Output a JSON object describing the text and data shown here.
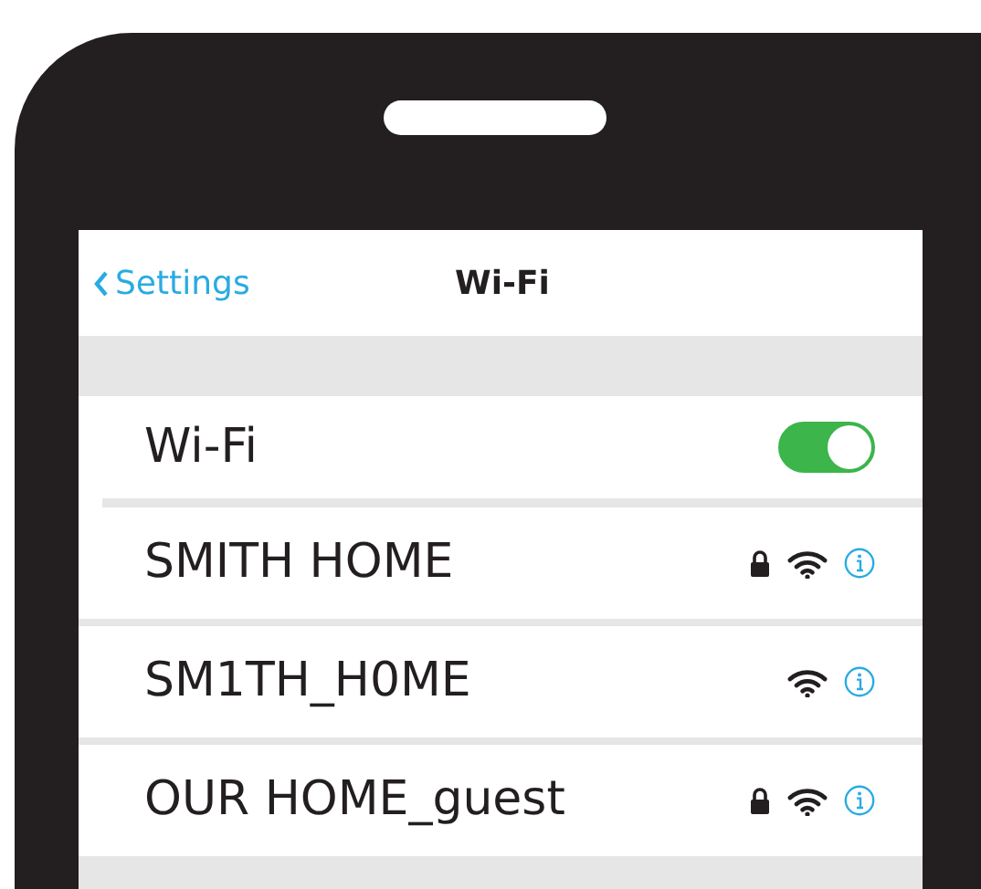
{
  "nav": {
    "back": "Settings",
    "title": "Wi-Fi"
  },
  "wifi_toggle": {
    "label": "Wi-Fi",
    "on": true
  },
  "networks": [
    {
      "name": "SMITH HOME",
      "locked": true
    },
    {
      "name": "SM1TH_H0ME",
      "locked": false
    },
    {
      "name": "OUR HOME_guest",
      "locked": true
    }
  ]
}
